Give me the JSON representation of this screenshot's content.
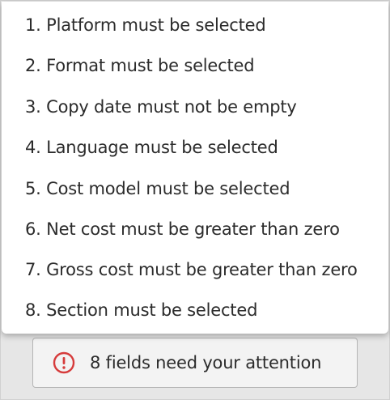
{
  "validation_popover": {
    "errors": [
      "1. Platform must be selected",
      "2. Format must be selected",
      "3. Copy date must not be empty",
      "4. Language must be selected",
      "5. Cost model must be selected",
      "6. Net cost must be greater than zero",
      "7. Gross cost must be greater than zero",
      "8. Section must be selected"
    ]
  },
  "alert_button": {
    "label": "8 fields need your attention",
    "icon": "exclamation-circle-icon",
    "icon_color": "#d63b3b"
  }
}
